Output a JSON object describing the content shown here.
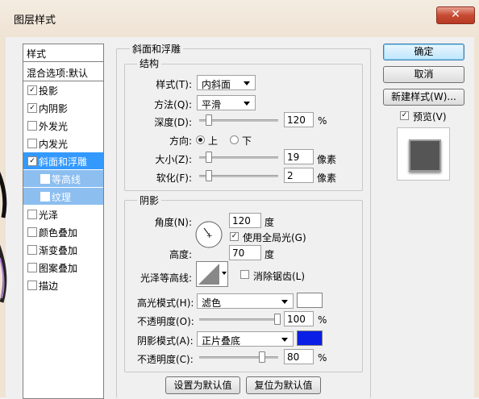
{
  "window": {
    "title": "图层样式",
    "close_glyph": "✕"
  },
  "styles_list": {
    "header": "样式",
    "blend": "混合选项:默认",
    "items": [
      {
        "label": "投影",
        "checked": true
      },
      {
        "label": "内阴影",
        "checked": true
      },
      {
        "label": "外发光",
        "checked": false
      },
      {
        "label": "内发光",
        "checked": false
      },
      {
        "label": "斜面和浮雕",
        "checked": true
      },
      {
        "label": "等高线",
        "checked": false
      },
      {
        "label": "纹理",
        "checked": false
      },
      {
        "label": "光泽",
        "checked": false
      },
      {
        "label": "颜色叠加",
        "checked": false
      },
      {
        "label": "渐变叠加",
        "checked": false
      },
      {
        "label": "图案叠加",
        "checked": false
      },
      {
        "label": "描边",
        "checked": false
      }
    ],
    "check_glyph": "✓"
  },
  "bevel": {
    "section_title": "斜面和浮雕",
    "structure_title": "结构",
    "style_label": "样式(T):",
    "style_value": "内斜面",
    "technique_label": "方法(Q):",
    "technique_value": "平滑",
    "depth_label": "深度(D):",
    "depth_value": "120",
    "depth_unit": "%",
    "direction_label": "方向:",
    "direction_up": "上",
    "direction_down": "下",
    "size_label": "大小(Z):",
    "size_value": "19",
    "size_unit": "像素",
    "soften_label": "软化(F):",
    "soften_value": "2",
    "soften_unit": "像素"
  },
  "shading": {
    "title": "阴影",
    "angle_label": "角度(N):",
    "angle_value": "120",
    "angle_unit": "度",
    "global_light_label": "使用全局光(G)",
    "global_light_checked": true,
    "altitude_label": "高度:",
    "altitude_value": "70",
    "altitude_unit": "度",
    "gloss_label": "光泽等高线:",
    "antialias_label": "消除锯齿(L)",
    "antialias_checked": false,
    "highlight_mode_label": "高光模式(H):",
    "highlight_mode_value": "滤色",
    "highlight_color": "#ffffff",
    "highlight_opacity_label": "不透明度(O):",
    "highlight_opacity_value": "100",
    "highlight_opacity_unit": "%",
    "shadow_mode_label": "阴影模式(A):",
    "shadow_mode_value": "正片叠底",
    "shadow_color": "#0a1ee6",
    "shadow_opacity_label": "不透明度(C):",
    "shadow_opacity_value": "80",
    "shadow_opacity_unit": "%"
  },
  "bottom_buttons": {
    "make_default": "设置为默认值",
    "reset_default": "复位为默认值"
  },
  "right_panel": {
    "ok": "确定",
    "cancel": "取消",
    "new_style": "新建样式(W)...",
    "preview_label": "预览(V)",
    "preview_checked": true
  }
}
